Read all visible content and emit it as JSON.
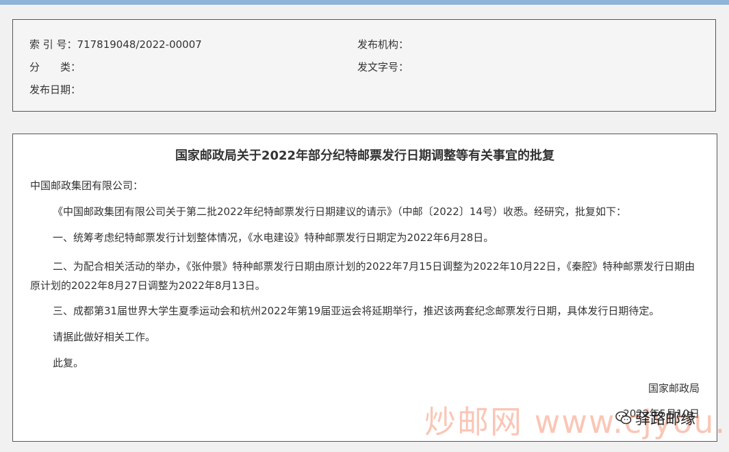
{
  "meta": {
    "index_label": "索 引 号：",
    "index_value": "717819048/2022-00007",
    "category_label": "分　　类：",
    "category_value": "",
    "date_label": "发布日期：",
    "date_value": "",
    "org_label": "发布机构：",
    "org_value": "",
    "docno_label": "发文字号：",
    "docno_value": ""
  },
  "document": {
    "title": "国家邮政局关于2022年部分纪特邮票发行日期调整等有关事宜的批复",
    "recipient": "中国邮政集团有限公司：",
    "paragraphs": [
      "《中国邮政集团有限公司关于第二批2022年纪特邮票发行日期建议的请示》（中邮〔2022〕14号）收悉。经研究，批复如下：",
      "一、统筹考虑纪特邮票发行计划整体情况，《水电建设》特种邮票发行日期定为2022年6月28日。",
      "二、为配合相关活动的举办，《张仲景》特种邮票发行日期由原计划的2022年7月15日调整为2022年10月22日，《秦腔》特种邮票发行日期由原计划的2022年8月27日调整为2022年8月13日。",
      "三、成都第31届世界大学生夏季运动会和杭州2022年第19届亚运会将延期举行，推迟该两套纪念邮票发行日期，具体发行日期待定。",
      "请据此做好相关工作。",
      "此复。"
    ],
    "signature": "国家邮政局",
    "sign_date": "2022年5月10日"
  },
  "overlay": {
    "watermark_text": "炒邮网 www.cjyou.net",
    "account_name": "驿路邮缘",
    "account_icon": "wechat-icon"
  }
}
